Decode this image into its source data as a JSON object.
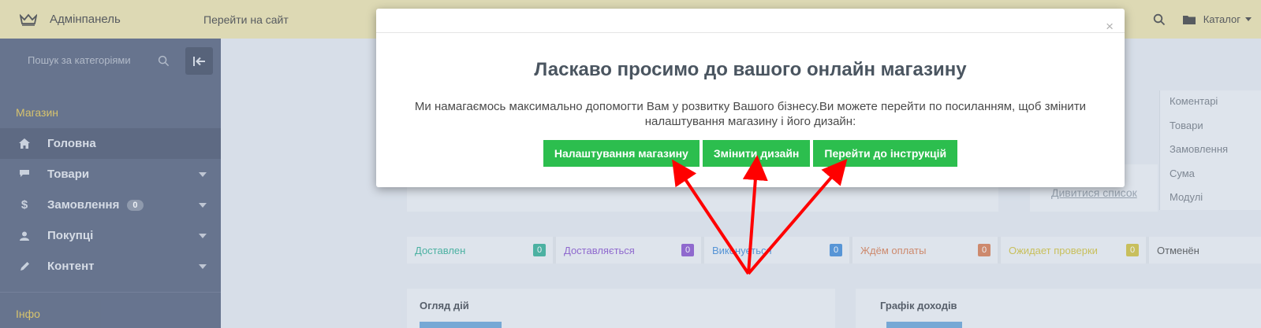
{
  "topbar": {
    "brand": "Адмінпанель",
    "goto_site": "Перейти на сайт",
    "catalog": "Каталог"
  },
  "sidebar": {
    "search_placeholder": "Пошук за категоріями",
    "section_shop": "Магазин",
    "section_info": "Інфо",
    "items": [
      {
        "label": "Головна",
        "icon": "home-icon"
      },
      {
        "label": "Товари",
        "icon": "tag-icon"
      },
      {
        "label": "Замовлення",
        "icon": "dollar-icon",
        "badge": "0"
      },
      {
        "label": "Покупці",
        "icon": "user-icon"
      },
      {
        "label": "Контент",
        "icon": "pencil-icon"
      }
    ]
  },
  "main": {
    "right_list": [
      "Коментарі",
      "Товари",
      "Замовлення",
      "Сума",
      "Модулі"
    ],
    "view_list": "Дивитися список",
    "statuses": [
      {
        "label": "Доставлен",
        "count": "0",
        "color": "#3cb39a"
      },
      {
        "label": "Доставляється",
        "count": "0",
        "color": "#8e5bd0"
      },
      {
        "label": "Виконується",
        "count": "0",
        "color": "#4a90d9"
      },
      {
        "label": "Ждём оплаты",
        "count": "0",
        "color": "#d9825a"
      },
      {
        "label": "Ожидает проверки",
        "count": "0",
        "color": "#d4c445"
      },
      {
        "label": "Отменён",
        "count": "",
        "color": "#555555"
      }
    ],
    "panel_activity": "Огляд дій",
    "panel_income": "Графік доходів"
  },
  "modal": {
    "close": "×",
    "title": "Ласкаво просимо до вашого онлайн магазину",
    "text": "Ми намагаємось максимально допомогти Вам у розвитку Вашого бізнесу.Ви можете перейти по посиланням, щоб змінити налаштування магазину і його дизайн:",
    "buttons": {
      "settings": "Налаштування магазину",
      "design": "Змінити дизайн",
      "instructions": "Перейти до інструкцій"
    }
  },
  "colors": {
    "topbar": "#ede3b0",
    "sidebar": "#5d6882",
    "accent_green": "#2cbe4e",
    "arrow_red": "#ff0000",
    "section_gold": "#e6c85a"
  }
}
